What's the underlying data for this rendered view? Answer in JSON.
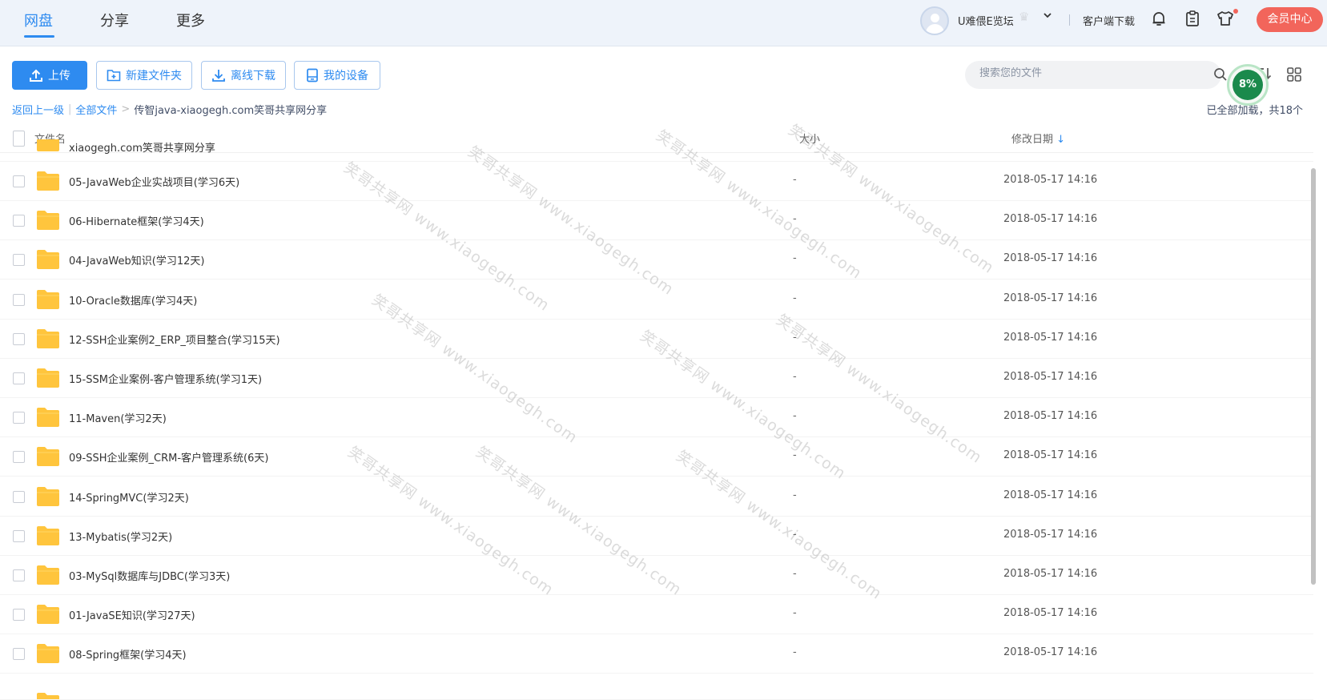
{
  "nav": {
    "tabs": [
      {
        "label": "网盘"
      },
      {
        "label": "分享"
      },
      {
        "label": "更多"
      }
    ]
  },
  "header": {
    "username": "U难偎E览坛",
    "client_download": "客户端下载",
    "vip_button": "会员中心",
    "icons": [
      "crown-icon",
      "chevron-down-icon",
      "bell-icon",
      "clipboard-icon",
      "shirt-icon"
    ]
  },
  "toolbar": {
    "upload": "上传",
    "new_folder": "新建文件夹",
    "offline_download": "离线下载",
    "my_devices": "我的设备",
    "search_placeholder": "搜索您的文件",
    "progress": "8%"
  },
  "breadcrumb": {
    "back": "返回上一级",
    "all_files": "全部文件",
    "separator": ">",
    "current": "传智java-xiaogegh.com笑哥共享网分享"
  },
  "status": {
    "loaded": "已全部加载，共18个"
  },
  "table": {
    "headers": {
      "name": "文件名",
      "size": "大小",
      "modified": "修改日期",
      "sort_arrow": "↓"
    },
    "partial_top_row": "xiaogegh.com笑哥共享网分享",
    "rows": [
      {
        "name": "05-JavaWeb企业实战项目(学习6天)",
        "size": "-",
        "date": "2018-05-17 14:16"
      },
      {
        "name": "06-Hibernate框架(学习4天)",
        "size": "-",
        "date": "2018-05-17 14:16"
      },
      {
        "name": "04-JavaWeb知识(学习12天)",
        "size": "-",
        "date": "2018-05-17 14:16"
      },
      {
        "name": "10-Oracle数据库(学习4天)",
        "size": "-",
        "date": "2018-05-17 14:16"
      },
      {
        "name": "12-SSH企业案例2_ERP_项目整合(学习15天)",
        "size": "-",
        "date": "2018-05-17 14:16"
      },
      {
        "name": "15-SSM企业案例-客户管理系统(学习1天)",
        "size": "-",
        "date": "2018-05-17 14:16"
      },
      {
        "name": "11-Maven(学习2天)",
        "size": "-",
        "date": "2018-05-17 14:16"
      },
      {
        "name": "09-SSH企业案例_CRM-客户管理系统(6天)",
        "size": "-",
        "date": "2018-05-17 14:16"
      },
      {
        "name": "14-SpringMVC(学习2天)",
        "size": "-",
        "date": "2018-05-17 14:16"
      },
      {
        "name": "13-Mybatis(学习2天)",
        "size": "-",
        "date": "2018-05-17 14:16"
      },
      {
        "name": "03-MySql数据库与JDBC(学习3天)",
        "size": "-",
        "date": "2018-05-17 14:16"
      },
      {
        "name": "01-JavaSE知识(学习27天)",
        "size": "-",
        "date": "2018-05-17 14:16"
      },
      {
        "name": "08-Spring框架(学习4天)",
        "size": "-",
        "date": "2018-05-17 14:16"
      }
    ]
  },
  "watermark": {
    "text": "笑哥共享网 www.xiaogegh.com"
  },
  "colors": {
    "accent": "#2e8bf0",
    "vip": "#f2655b",
    "folder": "#ffc53d",
    "progress": "#1b8a4c"
  }
}
